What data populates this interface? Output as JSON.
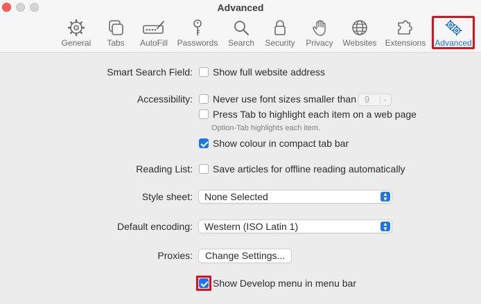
{
  "window": {
    "title": "Advanced"
  },
  "toolbar": {
    "tabs": [
      {
        "label": "General",
        "icon": "gear-icon"
      },
      {
        "label": "Tabs",
        "icon": "tabs-icon"
      },
      {
        "label": "AutoFill",
        "icon": "autofill-icon"
      },
      {
        "label": "Passwords",
        "icon": "key-icon"
      },
      {
        "label": "Search",
        "icon": "search-icon"
      },
      {
        "label": "Security",
        "icon": "lock-icon"
      },
      {
        "label": "Privacy",
        "icon": "hand-icon"
      },
      {
        "label": "Websites",
        "icon": "globe-icon"
      },
      {
        "label": "Extensions",
        "icon": "puzzle-icon"
      },
      {
        "label": "Advanced",
        "icon": "gears-icon",
        "active": true
      }
    ]
  },
  "settings": {
    "smart_search": {
      "label": "Smart Search Field:",
      "option": "Show full website address",
      "checked": false
    },
    "accessibility": {
      "label": "Accessibility:",
      "min_font_option": "Never use font sizes smaller than",
      "min_font_value": "9",
      "tab_highlight_option": "Press Tab to highlight each item on a web page",
      "tab_hint": "Option-Tab highlights each item.",
      "compact_colour_option": "Show colour in compact tab bar",
      "compact_colour_checked": true
    },
    "reading_list": {
      "label": "Reading List:",
      "option": "Save articles for offline reading automatically",
      "checked": false
    },
    "style_sheet": {
      "label": "Style sheet:",
      "value": "None Selected"
    },
    "encoding": {
      "label": "Default encoding:",
      "value": "Western (ISO Latin 1)"
    },
    "proxies": {
      "label": "Proxies:",
      "button": "Change Settings..."
    },
    "develop_menu": {
      "option": "Show Develop menu in menu bar",
      "checked": true
    }
  },
  "colors": {
    "accent": "#1c75e6",
    "highlight": "#e0101a"
  }
}
